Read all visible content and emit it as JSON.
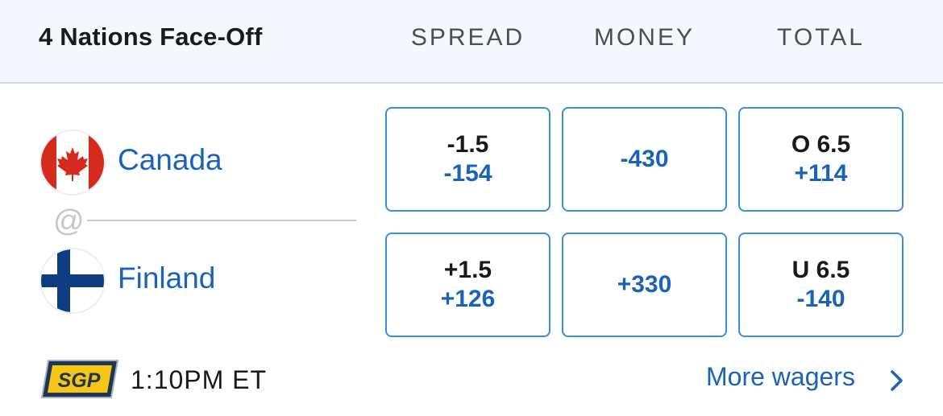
{
  "header": {
    "event_title": "4 Nations Face-Off",
    "columns": [
      "SPREAD",
      "MONEY",
      "TOTAL"
    ]
  },
  "matchup": {
    "separator": "@",
    "teams": [
      {
        "name": "Canada",
        "logo_icon": "canada-flag-icon",
        "spread": {
          "line": "-1.5",
          "price": "-154"
        },
        "money": {
          "price": "-430"
        },
        "total": {
          "line": "O 6.5",
          "price": "+114"
        }
      },
      {
        "name": "Finland",
        "logo_icon": "finland-flag-icon",
        "spread": {
          "line": "+1.5",
          "price": "+126"
        },
        "money": {
          "price": "+330"
        },
        "total": {
          "line": "U 6.5",
          "price": "-140"
        }
      }
    ]
  },
  "footer": {
    "sgp_badge": "SGP",
    "game_time": "1:10PM ET",
    "more_wagers": "More wagers",
    "chevron_icon": "chevron-right-icon"
  },
  "colors": {
    "accent_blue": "#1a63b8",
    "button_border": "#3b8de0",
    "header_bg": "#f4f7fb",
    "sgp_bg": "#1f3552",
    "sgp_text": "#f5c518"
  }
}
